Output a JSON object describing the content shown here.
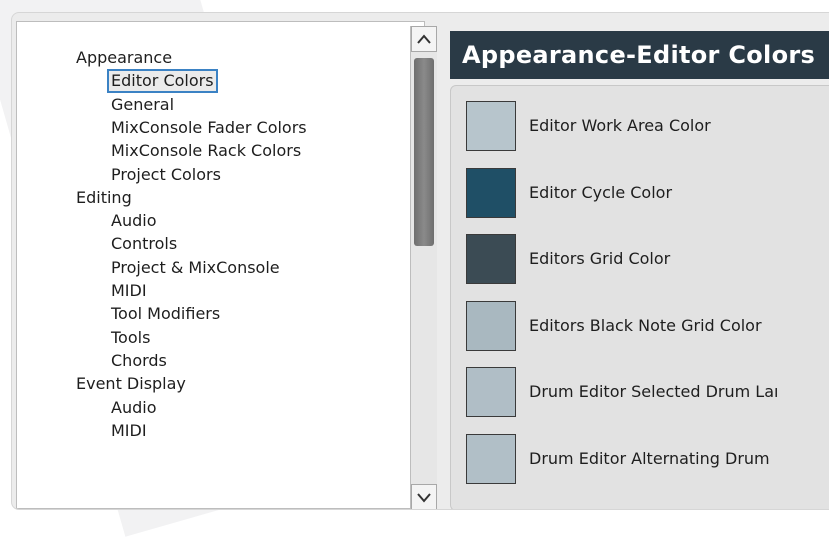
{
  "tree": {
    "items": [
      {
        "label": "Appearance",
        "level": 0
      },
      {
        "label": "Editor Colors",
        "level": 1,
        "selected": true
      },
      {
        "label": "General",
        "level": 1
      },
      {
        "label": "MixConsole Fader Colors",
        "level": 1
      },
      {
        "label": "MixConsole Rack Colors",
        "level": 1
      },
      {
        "label": "Project Colors",
        "level": 1
      },
      {
        "label": "Editing",
        "level": 0
      },
      {
        "label": "Audio",
        "level": 1
      },
      {
        "label": "Controls",
        "level": 1
      },
      {
        "label": "Project & MixConsole",
        "level": 1
      },
      {
        "label": "MIDI",
        "level": 1
      },
      {
        "label": "Tool Modifiers",
        "level": 1
      },
      {
        "label": "Tools",
        "level": 1
      },
      {
        "label": "Chords",
        "level": 1
      },
      {
        "label": "Event Display",
        "level": 0
      },
      {
        "label": "Audio",
        "level": 1
      },
      {
        "label": "MIDI",
        "level": 1
      }
    ]
  },
  "scrollbar": {
    "up_icon": "chevron-up-icon",
    "down_icon": "chevron-down-icon"
  },
  "panel": {
    "title": "Appearance-Editor Colors",
    "colors": [
      {
        "label": "Editor Work Area Color",
        "color": "#b7c5cc"
      },
      {
        "label": "Editor Cycle Color",
        "color": "#1f4f66"
      },
      {
        "label": "Editors Grid Color",
        "color": "#3b4b54"
      },
      {
        "label": "Editors Black Note Grid Color",
        "color": "#a9b8c0"
      },
      {
        "label": "Drum Editor Selected Drum Laı",
        "color": "#b0bec6"
      },
      {
        "label": "Drum Editor Alternating Drum",
        "color": "#b1bfc7"
      }
    ]
  },
  "theme": {
    "header_bg": "#2a3a46",
    "selection_outline": "#3b82c4"
  }
}
